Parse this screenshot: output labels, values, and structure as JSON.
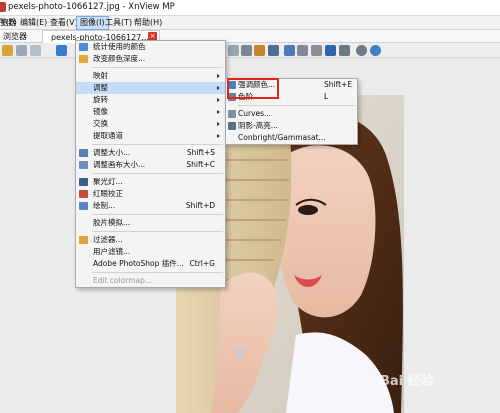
{
  "window": {
    "title": "pexels-photo-1066127.jpg - XnView MP"
  },
  "menubar": {
    "items": [
      {
        "label": "览器",
        "active": false
      },
      {
        "label": "件(F)",
        "active": false
      },
      {
        "label": "编辑(E)",
        "active": false
      },
      {
        "label": "查看(V)",
        "active": false
      },
      {
        "label": "图像(I)",
        "active": true
      },
      {
        "label": "工具(T)",
        "active": false
      },
      {
        "label": "帮助(H)",
        "active": false
      }
    ]
  },
  "tabs": {
    "explorer_label": "浏览器",
    "file_label": "pexels-photo-1066127...",
    "close_glyph": "×"
  },
  "image_menu": {
    "items": [
      {
        "label": "统计使用的颜色",
        "shortcut": "",
        "submenu": false
      },
      {
        "label": "改变颜色深度...",
        "shortcut": "",
        "submenu": false
      },
      {
        "sep": true
      },
      {
        "label": "映射",
        "shortcut": "",
        "submenu": true
      },
      {
        "label": "调整",
        "shortcut": "",
        "submenu": true,
        "highlight": true
      },
      {
        "label": "旋转",
        "shortcut": "",
        "submenu": true
      },
      {
        "label": "镜像",
        "shortcut": "",
        "submenu": true
      },
      {
        "label": "交换",
        "shortcut": "",
        "submenu": true
      },
      {
        "label": "提取通道",
        "shortcut": "",
        "submenu": true
      },
      {
        "sep": true
      },
      {
        "label": "调整大小...",
        "shortcut": "Shift+S",
        "submenu": false
      },
      {
        "label": "调整画布大小...",
        "shortcut": "Shift+C",
        "submenu": false
      },
      {
        "sep": true
      },
      {
        "label": "聚光灯...",
        "shortcut": "",
        "submenu": false
      },
      {
        "label": "红眼校正",
        "shortcut": "",
        "submenu": false
      },
      {
        "label": "绘制...",
        "shortcut": "Shift+D",
        "submenu": false
      },
      {
        "sep": true
      },
      {
        "label": "胶片模拟...",
        "shortcut": "",
        "submenu": false
      },
      {
        "sep": true
      },
      {
        "label": "过滤器...",
        "shortcut": "",
        "submenu": false
      },
      {
        "label": "用户滤镜...",
        "shortcut": "",
        "submenu": false
      },
      {
        "label": "Adobe PhotoShop 插件...",
        "shortcut": "Ctrl+G",
        "submenu": false
      },
      {
        "sep": true
      },
      {
        "label": "Edit colormap...",
        "shortcut": "",
        "submenu": false,
        "disabled": true
      }
    ]
  },
  "adjust_submenu": {
    "items": [
      {
        "label": "强调颜色...",
        "shortcut": "Shift+E"
      },
      {
        "label": "色阶...",
        "shortcut": "L"
      },
      {
        "sep": true
      },
      {
        "label": "Curves...",
        "shortcut": ""
      },
      {
        "label": "阴影-高亮...",
        "shortcut": ""
      },
      {
        "label": "Conbright/Gammasat...",
        "shortcut": ""
      }
    ]
  },
  "watermark": "Bai 经验",
  "colors": {
    "highlight": "#c7ddf5",
    "callout": "#e0241c"
  }
}
